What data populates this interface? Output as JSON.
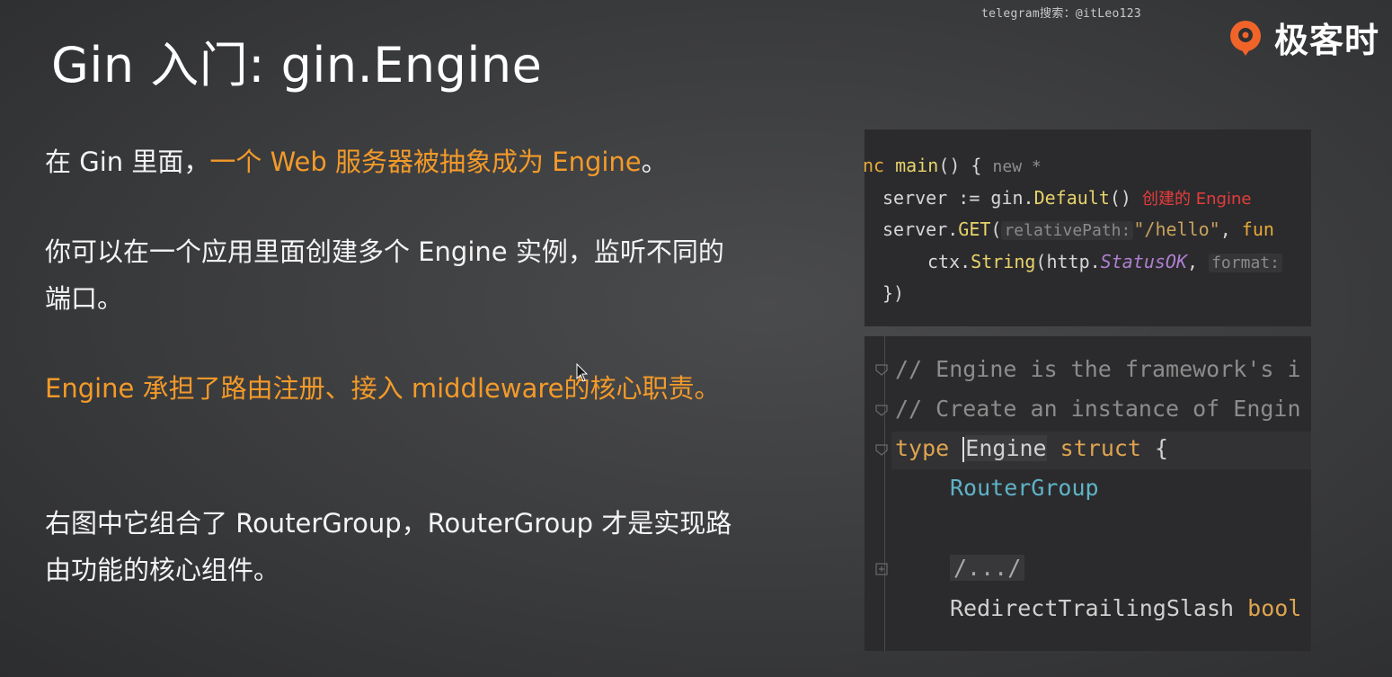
{
  "watermark": "telegram搜索：@itLeo123",
  "brand": {
    "name": "极客时",
    "logo_icon": "geektime-logo-icon",
    "accent": "#f0642a"
  },
  "slide": {
    "title": "Gin 入门: gin.Engine",
    "p1_a": "在 Gin 里面，",
    "p1_b": "一个 Web 服务器被抽象成为 Engine",
    "p1_c": "。",
    "p2": "你可以在一个应用里面创建多个 Engine 实例，监听不同的端口。",
    "p3": "Engine 承担了路由注册、接入 middleware的核心职责。",
    "p4": "右图中它组合了 RouterGroup，RouterGroup 才是实现路由功能的核心组件。"
  },
  "colors": {
    "highlight": "#f39a29",
    "annotation": "#e53c3c"
  },
  "code_top": {
    "l1_kw": "nc",
    "l1_fn": "main",
    "l1_rest": "() {",
    "l1_hint": "new *",
    "l2_a": "server := gin.",
    "l2_fn": "Default",
    "l2_b": "()",
    "l2_note": "创建的 Engine",
    "l3_a": "server.",
    "l3_fn": "GET",
    "l3_b": "(",
    "l3_hint": "relativePath:",
    "l3_str": "\"/hello\"",
    "l3_c": ", ",
    "l3_kw": "fun",
    "l4_a": "ctx.",
    "l4_fn": "String",
    "l4_b": "(http.",
    "l4_italic": "StatusOK",
    "l4_c": ",",
    "l4_hint": "format:",
    "l5": "})"
  },
  "code_bottom": {
    "l1": "// Engine is the framework's i",
    "l2": "// Create an instance of Engin",
    "l3_kw": "type",
    "l3_name_first": "E",
    "l3_name_rest": "ngine",
    "l3_kw2": "struct",
    "l3_brace": "{",
    "l4": "RouterGroup",
    "l5": "/.../",
    "l6_field": "RedirectTrailingSlash",
    "l6_type": "bool"
  }
}
